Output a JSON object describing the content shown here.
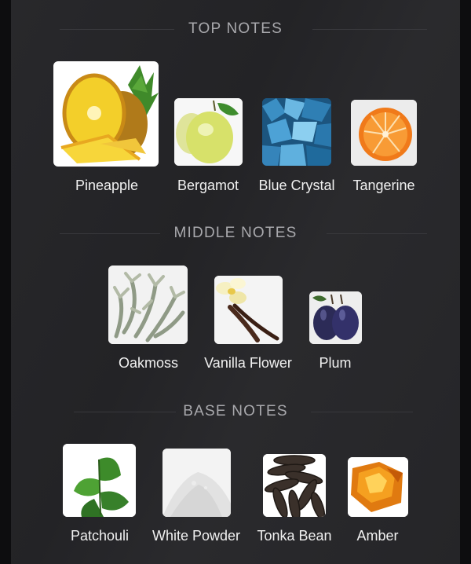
{
  "sections": {
    "top": {
      "title": "TOP NOTES",
      "notes": [
        {
          "name": "Pineapple",
          "icon": "pineapple-image"
        },
        {
          "name": "Bergamot",
          "icon": "bergamot-image"
        },
        {
          "name": "Blue Crystal",
          "icon": "blue-crystal-image"
        },
        {
          "name": "Tangerine",
          "icon": "tangerine-image"
        }
      ]
    },
    "middle": {
      "title": "MIDDLE NOTES",
      "notes": [
        {
          "name": "Oakmoss",
          "icon": "oakmoss-image"
        },
        {
          "name": "Vanilla Flower",
          "icon": "vanilla-flower-image"
        },
        {
          "name": "Plum",
          "icon": "plum-image"
        }
      ]
    },
    "base": {
      "title": "BASE NOTES",
      "notes": [
        {
          "name": "Patchouli",
          "icon": "patchouli-image"
        },
        {
          "name": "White Powder",
          "icon": "white-powder-image"
        },
        {
          "name": "Tonka Bean",
          "icon": "tonka-bean-image"
        },
        {
          "name": "Amber",
          "icon": "amber-image"
        }
      ]
    }
  },
  "colors": {
    "background": "#242427",
    "heading": "#a9a9ad",
    "label": "#f1f1f1"
  }
}
